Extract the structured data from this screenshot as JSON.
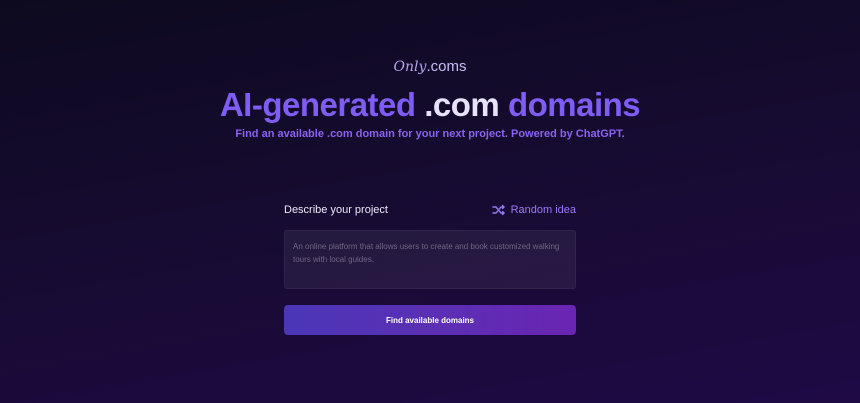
{
  "logo": {
    "only": "Only",
    "coms": ".coms"
  },
  "headline": {
    "part1": "AI-generated",
    "part2": ".com",
    "part3": "domains"
  },
  "tagline": "Find an available .com domain for your next project. Powered by ChatGPT.",
  "form": {
    "label": "Describe your project",
    "random_label": "Random idea",
    "random_icon": "shuffle-icon",
    "textarea_placeholder": "An online platform that allows users to create and book customized walking tours with local guides.",
    "textarea_value": "",
    "submit_label": "Find available domains"
  },
  "colors": {
    "accent": "#7f5cf3",
    "background": "#150b2e",
    "button_start": "#4b36b8",
    "button_end": "#6b25b3"
  }
}
